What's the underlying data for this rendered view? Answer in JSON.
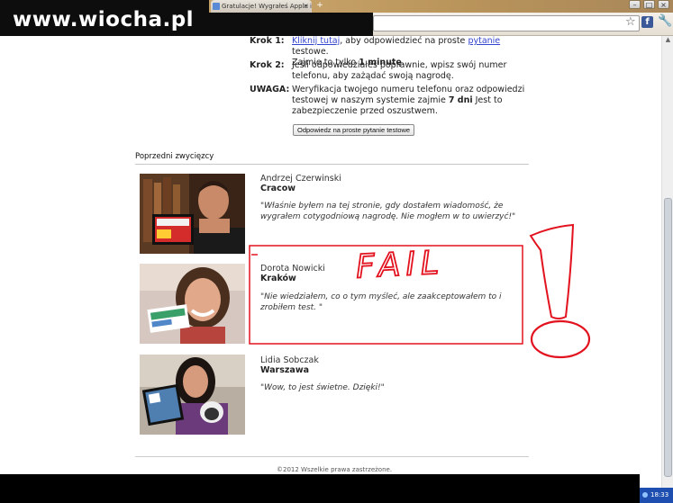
{
  "watermark": "www.wiocha.pl",
  "browser": {
    "tab_title": "Gratulacje! Wygrałeś Apple iP",
    "tab_close": "×",
    "new_tab": "+",
    "window_controls": [
      "–",
      "□",
      "×"
    ],
    "clock": "18:33"
  },
  "steps": [
    {
      "label": "Krok 1:",
      "link1": "Kliknij tutaj",
      "text1": ", aby odpowiedzieć na proste ",
      "link2": "pytanie",
      "text2": " testowe.",
      "line2": "Zajmie to tylko ",
      "emph": "1 minutę",
      "tail": "."
    },
    {
      "label": "Krok 2:",
      "text": "Jeśli odpowiedziałeś poprawnie, wpisz swój numer telefonu, aby zażądać swoją nagrodę."
    },
    {
      "label": "UWAGA:",
      "text1": "Weryfikacja twojego numeru telefonu oraz odpowiedzi testowej w naszym systemie zajmie ",
      "emph": "7 dni",
      "text2": " Jest to zabezpieczenie przed oszustwem."
    }
  ],
  "answer_button": "Odpowiedz na proste pytanie testowe",
  "winners_title": "Poprzedni zwycięzcy",
  "winners": [
    {
      "name": "Andrzej Czerwinski",
      "city": "Cracow",
      "quote": "\"Właśnie byłem na tej stronie, gdy dostałem wiadomość, że wygrałem cotygodniową nagrodę. Nie mogłem w to uwierzyć!\""
    },
    {
      "name": "Dorota Nowicki",
      "city": "Kraków",
      "quote": "\"Nie wiedziałem, co o tym myśleć, ale zaakceptowałem to i zrobiłem test. \""
    },
    {
      "name": "Lidia Sobczak",
      "city": "Warszawa",
      "quote": "\"Wow, to jest świetne. Dzięki!\""
    }
  ],
  "annotation_text": "FAIL",
  "footer": "©2012 Wszelkie prawa zastrzeżone.",
  "colors": {
    "link": "#3344cc",
    "annotation": "#e3121f",
    "taskbar": "#000000"
  },
  "icons": [
    "star-icon",
    "facebook-icon",
    "wrench-icon"
  ]
}
